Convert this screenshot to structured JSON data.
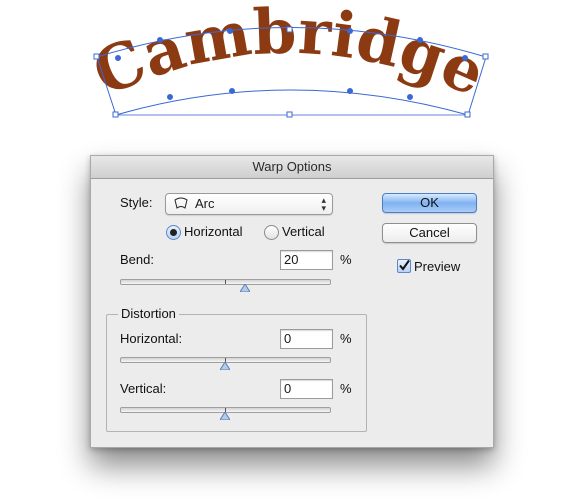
{
  "artwork": {
    "text": "Cambridge",
    "text_color": "#8b3a12",
    "warp_outline_color": "#3b68d6"
  },
  "dialog": {
    "title": "Warp Options",
    "style": {
      "label": "Style:",
      "selected": "Arc",
      "icon": "arc-icon"
    },
    "orientation": {
      "horizontal_label": "Horizontal",
      "vertical_label": "Vertical",
      "selected": "Horizontal"
    },
    "bend": {
      "label": "Bend:",
      "value": "20",
      "unit": "%",
      "slider_value": 20
    },
    "distortion": {
      "group_label": "Distortion",
      "horizontal": {
        "label": "Horizontal:",
        "value": "0",
        "unit": "%",
        "slider_value": 0
      },
      "vertical": {
        "label": "Vertical:",
        "value": "0",
        "unit": "%",
        "slider_value": 0
      }
    },
    "buttons": {
      "ok": "OK",
      "cancel": "Cancel"
    },
    "preview": {
      "label": "Preview",
      "checked": true
    },
    "accent_color": "#6aa2ee"
  }
}
